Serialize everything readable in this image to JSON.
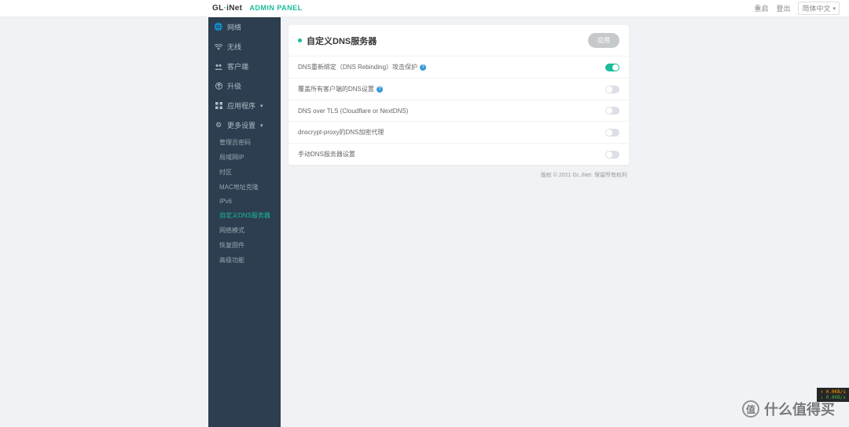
{
  "header": {
    "brand_prefix": "GL",
    "brand_dot": "·",
    "brand_suffix": "iNet",
    "admin_panel": "ADMIN PANEL",
    "reboot": "重启",
    "logout": "登出",
    "language": "简体中文"
  },
  "sidebar": {
    "items": [
      {
        "icon": "globe",
        "label": "网络"
      },
      {
        "icon": "wifi",
        "label": "无线"
      },
      {
        "icon": "users",
        "label": "客户端"
      },
      {
        "icon": "upgrade",
        "label": "升级"
      },
      {
        "icon": "apps",
        "label": "应用程序",
        "caret": true
      },
      {
        "icon": "gear",
        "label": "更多设置",
        "caret": true
      }
    ],
    "subs": [
      "管理员密码",
      "局域网IP",
      "时区",
      "MAC地址克隆",
      "IPv6",
      "自定义DNS服务器",
      "网络模式",
      "恢复固件",
      "高级功能"
    ]
  },
  "panel": {
    "title": "自定义DNS服务器",
    "apply": "应用",
    "rows": [
      {
        "label": "DNS重新绑定（DNS Rebinding）攻击保护",
        "info": true,
        "on": true
      },
      {
        "label": "覆盖所有客户端的DNS设置",
        "info": true,
        "on": false
      },
      {
        "label": "DNS over TLS (Cloudflare or NextDNS)",
        "info": false,
        "on": false
      },
      {
        "label": "dnscrypt-proxy的DNS加密代理",
        "info": false,
        "on": false
      },
      {
        "label": "手动DNS服务器设置",
        "info": false,
        "on": false
      }
    ]
  },
  "footer": "版权 © 2021 GL.iNet. 保留所有权利",
  "watermark": "什么值得买",
  "speed": {
    "up": "↑ 0.0KB/s",
    "down": "↓ 0.0KB/s"
  }
}
